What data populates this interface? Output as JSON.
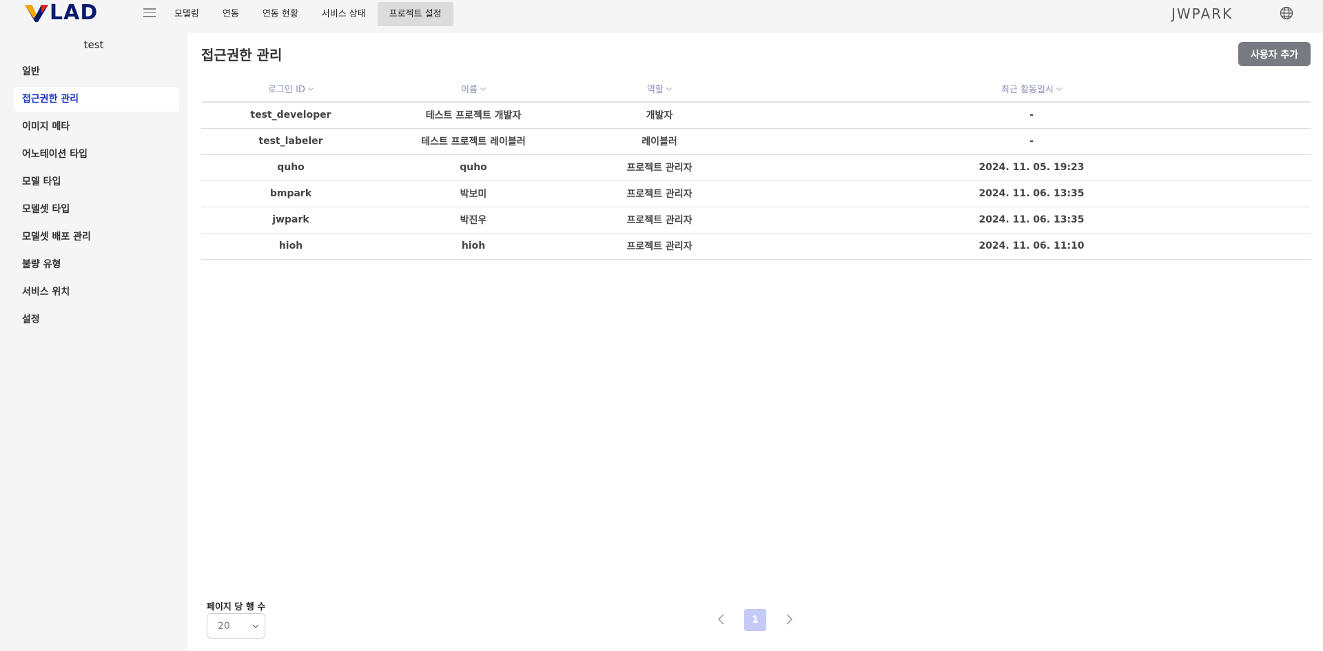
{
  "header": {
    "logo_text": "LAD",
    "nav": [
      "모델링",
      "연동",
      "연동 현황",
      "서비스 상태",
      "프로젝트 설정"
    ],
    "active_nav": "프로젝트 설정",
    "username": "JWPARK"
  },
  "sidebar": {
    "project_name": "test",
    "items": [
      "일반",
      "접근권한 관리",
      "이미지 메타",
      "어노테이션 타입",
      "모델 타입",
      "모델셋 타입",
      "모델셋 배포 관리",
      "불량 유형",
      "서비스 위치",
      "설정"
    ],
    "active_item": "접근권한 관리"
  },
  "main": {
    "title": "접근권한 관리",
    "add_button": "사용자 추가",
    "table": {
      "columns": [
        "로그인 ID",
        "이름",
        "역할",
        "최근 활동일시"
      ],
      "rows": [
        [
          "test_developer",
          "테스트 프로젝트 개발자",
          "개발자",
          "-"
        ],
        [
          "test_labeler",
          "테스트 프로젝트 레이블러",
          "레이블러",
          "-"
        ],
        [
          "quho",
          "quho",
          "프로젝트 관리자",
          "2024. 11. 05. 19:23"
        ],
        [
          "bmpark",
          "박보미",
          "프로젝트 관리자",
          "2024. 11. 06. 13:35"
        ],
        [
          "jwpark",
          "박진우",
          "프로젝트 관리자",
          "2024. 11. 06. 13:35"
        ],
        [
          "hioh",
          "hioh",
          "프로젝트 관리자",
          "2024. 11. 06. 11:10"
        ]
      ]
    }
  },
  "pagination": {
    "rows_per_page_label": "페이지 당 행 수",
    "rows_per_page": "20",
    "current_page": "1"
  },
  "colors": {
    "accent": "#1e34c8",
    "page_active": "#c5c9f5",
    "button": "#777a80"
  }
}
